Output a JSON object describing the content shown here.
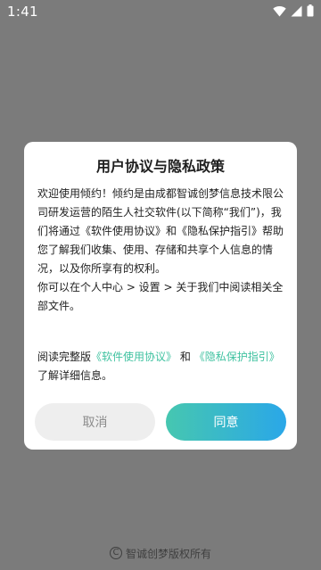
{
  "status_bar": {
    "time": "1:41",
    "icons": [
      "wifi-icon",
      "cellular-signal-icon",
      "battery-icon"
    ]
  },
  "dialog": {
    "title": "用户协议与隐私政策",
    "paragraphs": [
      "欢迎使用倾约！倾约是由成都智诚创梦信息技术限公司研发运营的陌生人社交软件(以下简称“我们”)，我们将通过《软件使用协议》和《隐私保护指引》帮助您了解我们收集、使用、存储和共享个人信息的情况，以及你所享有的权利。",
      "你可以在个人中心 > 设置 > 关于我们中阅读相关全部文件。"
    ],
    "notice": {
      "prefix": "阅读完整版",
      "link_agreement": "《软件使用协议》",
      "conjunction": "和",
      "link_privacy": "《隐私保护指引》",
      "suffix": "了解详细信息。"
    },
    "cancel_label": "取消",
    "agree_label": "同意"
  },
  "footer": {
    "copyright_symbol": "C",
    "text": "智诚创梦版权所有"
  },
  "colors": {
    "overlay": "#7b7b7b",
    "link": "#3fc2a0",
    "agree_gradient_start": "#46c7b0",
    "agree_gradient_end": "#2aa7e8",
    "cancel_bg": "#eeeeee"
  }
}
